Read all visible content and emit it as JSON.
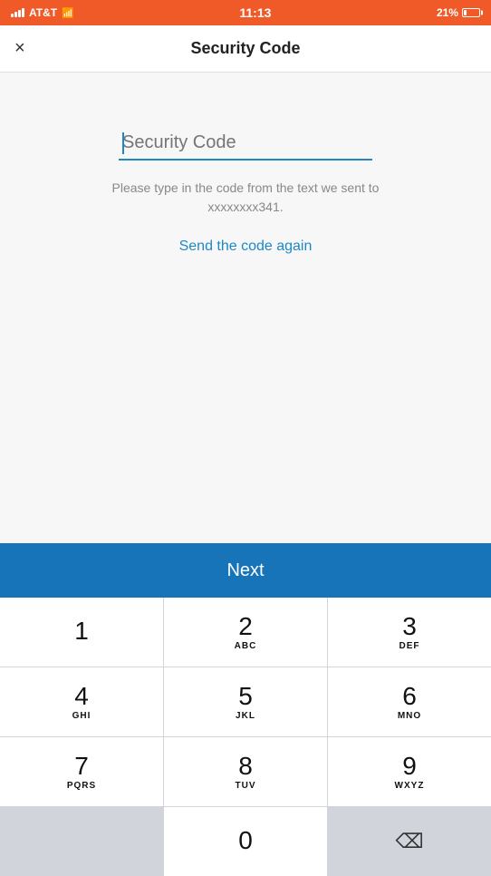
{
  "statusBar": {
    "carrier": "AT&T",
    "time": "11:13",
    "battery": "21%"
  },
  "navBar": {
    "title": "Security Code",
    "closeLabel": "×"
  },
  "form": {
    "inputPlaceholder": "Security Code",
    "helpText": "Please type in the code from the text we sent to xxxxxxxx341.",
    "resendLabel": "Send the code again"
  },
  "nextButton": {
    "label": "Next"
  },
  "keypad": {
    "keys": [
      {
        "number": "1",
        "letters": ""
      },
      {
        "number": "2",
        "letters": "ABC"
      },
      {
        "number": "3",
        "letters": "DEF"
      },
      {
        "number": "4",
        "letters": "GHI"
      },
      {
        "number": "5",
        "letters": "JKL"
      },
      {
        "number": "6",
        "letters": "MNO"
      },
      {
        "number": "7",
        "letters": "PQRS"
      },
      {
        "number": "8",
        "letters": "TUV"
      },
      {
        "number": "9",
        "letters": "WXYZ"
      },
      {
        "number": "0",
        "letters": ""
      }
    ]
  }
}
